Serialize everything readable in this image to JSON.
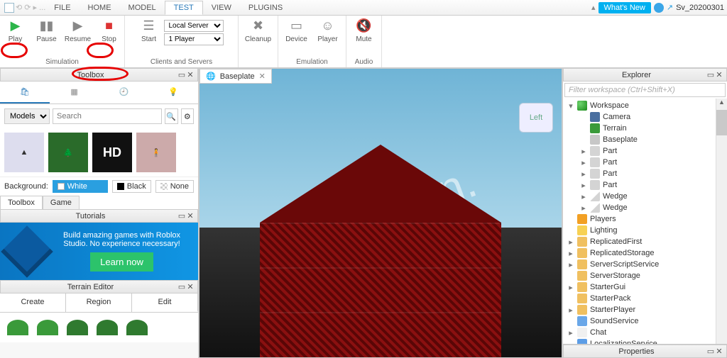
{
  "menu": {
    "tabs": [
      "FILE",
      "HOME",
      "MODEL",
      "TEST",
      "VIEW",
      "PLUGINS"
    ],
    "active": 3,
    "user": "Sv_20200301",
    "whats_new": "What's New"
  },
  "ribbon": {
    "sim": {
      "title": "Simulation",
      "play": "Play",
      "pause": "Pause",
      "resume": "Resume",
      "stop": "Stop"
    },
    "cs": {
      "title": "Clients and Servers",
      "local": "Local Server",
      "players": "1 Player",
      "start": "Start",
      "cleanup": "Cleanup"
    },
    "emu": {
      "title": "Emulation",
      "device": "Device",
      "player": "Player"
    },
    "aud": {
      "title": "Audio",
      "mute": "Mute"
    }
  },
  "toolbox": {
    "title": "Toolbox",
    "category": "Models",
    "search_ph": "Search",
    "bg_label": "Background:",
    "bg_white": "White",
    "bg_black": "Black",
    "bg_none": "None",
    "sub_toolbox": "Toolbox",
    "sub_game": "Game"
  },
  "tutorials": {
    "title": "Tutorials",
    "body": "Build amazing games with Roblox Studio. No experience necessary!",
    "btn": "Learn now"
  },
  "terrain": {
    "title": "Terrain Editor",
    "create": "Create",
    "region": "Region",
    "edit": "Edit"
  },
  "viewport": {
    "tab": "Baseplate",
    "cube": "Left"
  },
  "explorer": {
    "title": "Explorer",
    "filter_ph": "Filter workspace (Ctrl+Shift+X)",
    "nodes": [
      {
        "d": 0,
        "tw": "▾",
        "ic": "globe",
        "name": "Workspace"
      },
      {
        "d": 1,
        "tw": "",
        "ic": "cam",
        "name": "Camera"
      },
      {
        "d": 1,
        "tw": "",
        "ic": "terrain",
        "name": "Terrain"
      },
      {
        "d": 1,
        "tw": "",
        "ic": "bp",
        "name": "Baseplate"
      },
      {
        "d": 1,
        "tw": "▸",
        "ic": "part",
        "name": "Part"
      },
      {
        "d": 1,
        "tw": "▸",
        "ic": "part",
        "name": "Part"
      },
      {
        "d": 1,
        "tw": "▸",
        "ic": "part",
        "name": "Part"
      },
      {
        "d": 1,
        "tw": "▸",
        "ic": "part",
        "name": "Part"
      },
      {
        "d": 1,
        "tw": "▸",
        "ic": "wedge",
        "name": "Wedge"
      },
      {
        "d": 1,
        "tw": "▸",
        "ic": "wedge",
        "name": "Wedge"
      },
      {
        "d": 0,
        "tw": "",
        "ic": "players",
        "name": "Players"
      },
      {
        "d": 0,
        "tw": "",
        "ic": "light",
        "name": "Lighting"
      },
      {
        "d": 0,
        "tw": "▸",
        "ic": "folder",
        "name": "ReplicatedFirst"
      },
      {
        "d": 0,
        "tw": "▸",
        "ic": "folder",
        "name": "ReplicatedStorage"
      },
      {
        "d": 0,
        "tw": "▸",
        "ic": "folder",
        "name": "ServerScriptService"
      },
      {
        "d": 0,
        "tw": "",
        "ic": "folder",
        "name": "ServerStorage"
      },
      {
        "d": 0,
        "tw": "▸",
        "ic": "folder",
        "name": "StarterGui"
      },
      {
        "d": 0,
        "tw": "",
        "ic": "folder",
        "name": "StarterPack"
      },
      {
        "d": 0,
        "tw": "▸",
        "ic": "folder",
        "name": "StarterPlayer"
      },
      {
        "d": 0,
        "tw": "",
        "ic": "sound",
        "name": "SoundService"
      },
      {
        "d": 0,
        "tw": "▸",
        "ic": "chat",
        "name": "Chat"
      },
      {
        "d": 0,
        "tw": "",
        "ic": "loc",
        "name": "LocalizationService"
      }
    ]
  },
  "properties": {
    "title": "Properties"
  },
  "watermark": "robloxfan."
}
